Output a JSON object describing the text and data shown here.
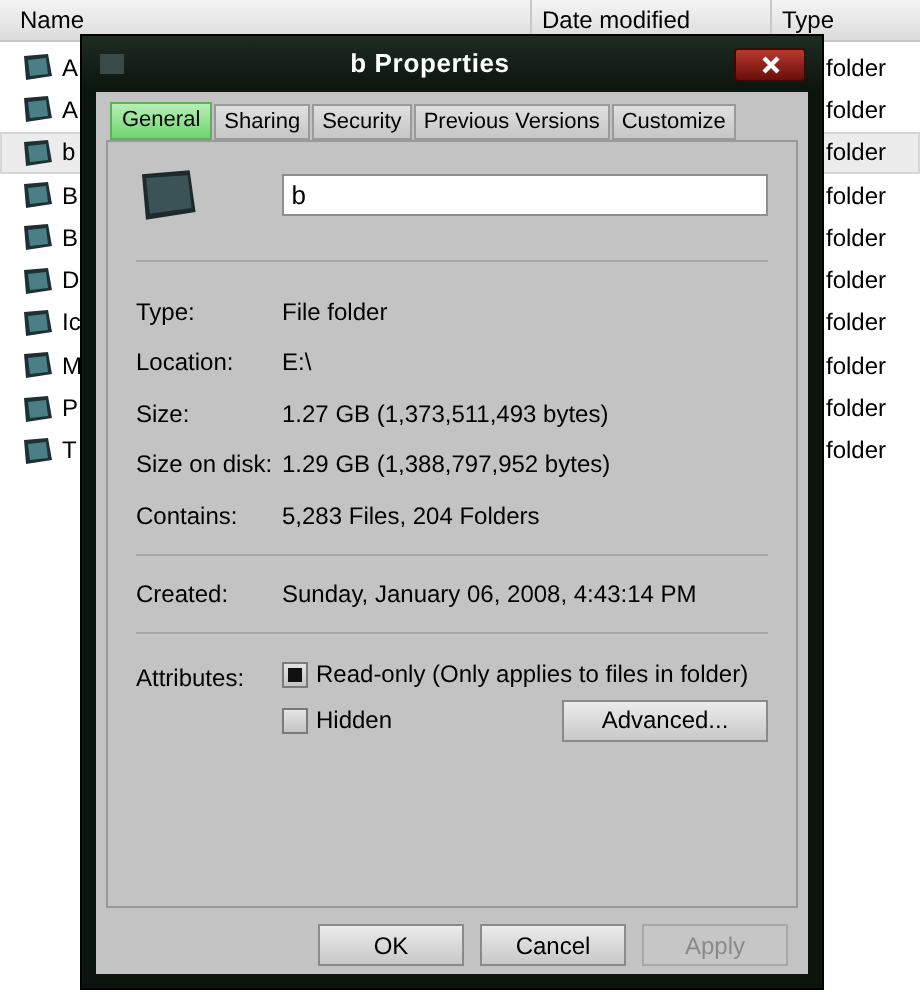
{
  "explorer": {
    "columns": [
      "Name",
      "Date modified",
      "Type"
    ],
    "rows": [
      {
        "name": "A",
        "type": "folder",
        "selected": false
      },
      {
        "name": "A",
        "type": "folder",
        "selected": false
      },
      {
        "name": "b",
        "type": "folder",
        "selected": true
      },
      {
        "name": "B",
        "type": "folder",
        "selected": false
      },
      {
        "name": "B",
        "type": "folder",
        "selected": false
      },
      {
        "name": "D",
        "type": "folder",
        "selected": false
      },
      {
        "name": "Ic",
        "type": "folder",
        "selected": false
      },
      {
        "name": "M",
        "type": "folder",
        "selected": false
      },
      {
        "name": "P",
        "type": "folder",
        "selected": false
      },
      {
        "name": "T",
        "type": "folder",
        "selected": false
      }
    ]
  },
  "dialog": {
    "title": "b Properties",
    "tabs": [
      {
        "label": "General",
        "selected": true
      },
      {
        "label": "Sharing",
        "selected": false
      },
      {
        "label": "Security",
        "selected": false
      },
      {
        "label": "Previous Versions",
        "selected": false
      },
      {
        "label": "Customize",
        "selected": false
      }
    ],
    "name_field": {
      "value": "b"
    },
    "properties": [
      {
        "label": "Type:",
        "value": "File folder"
      },
      {
        "label": "Location:",
        "value": "E:\\"
      },
      {
        "label": "Size:",
        "value": "1.27 GB (1,373,511,493 bytes)"
      },
      {
        "label": "Size on disk:",
        "value": "1.29 GB (1,388,797,952 bytes)"
      },
      {
        "label": "Contains:",
        "value": "5,283 Files, 204 Folders"
      }
    ],
    "created": {
      "label": "Created:",
      "value": "Sunday, January 06, 2008, 4:43:14 PM"
    },
    "attributes": {
      "label": "Attributes:",
      "items": [
        {
          "label": "Read-only (Only applies to files in folder)",
          "checked": true
        },
        {
          "label": "Hidden",
          "checked": false
        }
      ],
      "advanced_button": "Advanced..."
    },
    "buttons": [
      {
        "label": "OK",
        "disabled": false
      },
      {
        "label": "Cancel",
        "disabled": false
      },
      {
        "label": "Apply",
        "disabled": true
      }
    ]
  }
}
